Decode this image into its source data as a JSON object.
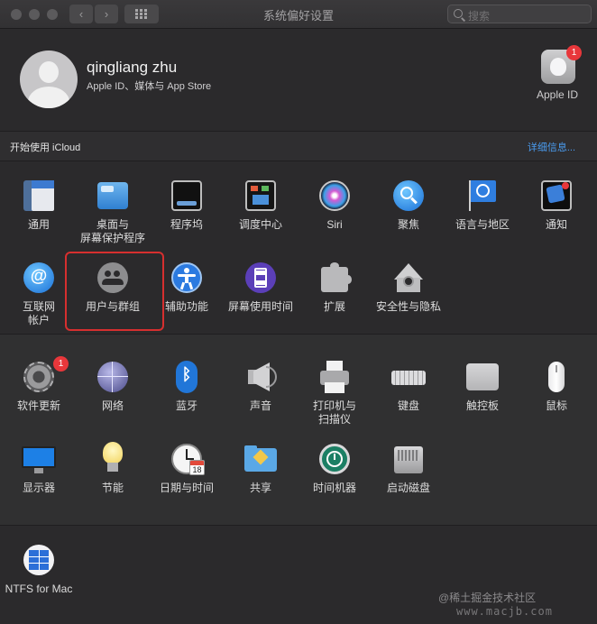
{
  "window": {
    "title": "系统偏好设置",
    "search_placeholder": "搜索",
    "back_glyph": "‹",
    "forward_glyph": "›"
  },
  "account": {
    "name": "qingliang zhu",
    "subtitle": "Apple ID、媒体与 App Store",
    "apple_id_label": "Apple ID",
    "apple_id_badge": "1"
  },
  "icloud": {
    "prompt": "开始使用 iCloud",
    "details_link": "详细信息..."
  },
  "section1": [
    {
      "label": "通用",
      "icon": "general-icon"
    },
    {
      "label": "桌面与\n屏幕保护程序",
      "icon": "desktop-screensaver-icon"
    },
    {
      "label": "程序坞",
      "icon": "dock-icon"
    },
    {
      "label": "调度中心",
      "icon": "mission-control-icon"
    },
    {
      "label": "Siri",
      "icon": "siri-icon"
    },
    {
      "label": "聚焦",
      "icon": "spotlight-icon"
    },
    {
      "label": "语言与地区",
      "icon": "language-region-icon"
    },
    {
      "label": "通知",
      "icon": "notifications-icon"
    },
    {
      "label": "互联网\n帐户",
      "icon": "internet-accounts-icon"
    },
    {
      "label": "用户与群组",
      "icon": "users-groups-icon"
    },
    {
      "label": "辅助功能",
      "icon": "accessibility-icon"
    },
    {
      "label": "屏幕使用时间",
      "icon": "screen-time-icon"
    },
    {
      "label": "扩展",
      "icon": "extensions-icon"
    },
    {
      "label": "安全性与隐私",
      "icon": "security-privacy-icon"
    }
  ],
  "section2": [
    {
      "label": "软件更新",
      "icon": "software-update-icon",
      "badge": "1"
    },
    {
      "label": "网络",
      "icon": "network-icon"
    },
    {
      "label": "蓝牙",
      "icon": "bluetooth-icon"
    },
    {
      "label": "声音",
      "icon": "sound-icon"
    },
    {
      "label": "打印机与\n扫描仪",
      "icon": "printers-scanners-icon"
    },
    {
      "label": "键盘",
      "icon": "keyboard-icon"
    },
    {
      "label": "触控板",
      "icon": "trackpad-icon"
    },
    {
      "label": "鼠标",
      "icon": "mouse-icon"
    },
    {
      "label": "显示器",
      "icon": "displays-icon"
    },
    {
      "label": "节能",
      "icon": "energy-saver-icon"
    },
    {
      "label": "日期与时间",
      "icon": "date-time-icon"
    },
    {
      "label": "共享",
      "icon": "sharing-icon"
    },
    {
      "label": "时间机器",
      "icon": "time-machine-icon"
    },
    {
      "label": "启动磁盘",
      "icon": "startup-disk-icon"
    }
  ],
  "section3": [
    {
      "label": "NTFS for Mac",
      "icon": "ntfs-for-mac-icon"
    }
  ],
  "calendar_day": "18",
  "watermark": {
    "line1": "@稀土掘金技术社区",
    "line2": "www.macjb.com"
  },
  "colors": {
    "background": "#2b2a2c",
    "link": "#4a9cf0",
    "badge": "#e8373b",
    "highlight_box": "#d62f2f"
  }
}
